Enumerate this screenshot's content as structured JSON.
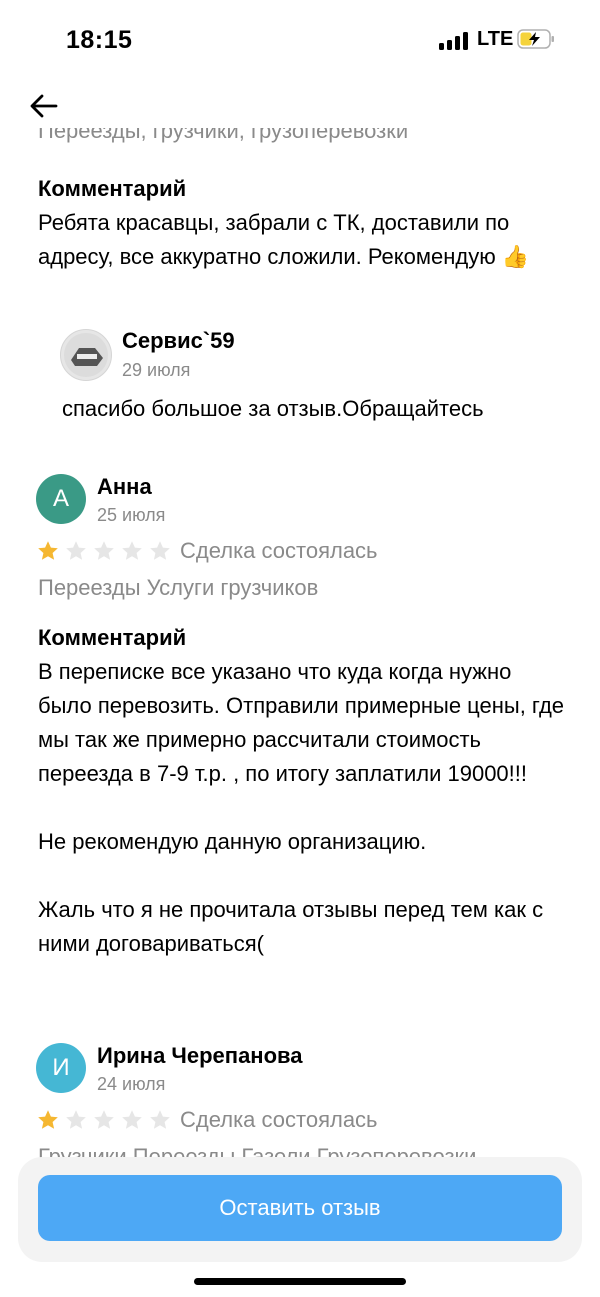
{
  "status_bar": {
    "time": "18:15",
    "network": "LTE"
  },
  "top": {
    "cut_text": "Переезды, грузчики, грузоперевозки"
  },
  "reviews": [
    {
      "comment_label": "Комментарий",
      "comment": "Ребята красавцы, забрали с ТК, доставили по адресу, все аккуратно сложили. Рекомендую 👍",
      "reply": {
        "author": "Сервис`59",
        "date": "29 июля",
        "text": "спасибо большое за отзыв.Обращайтесь"
      }
    },
    {
      "avatar_letter": "А",
      "avatar_color": "#3a9a86",
      "author": "Анна",
      "date": "25 июля",
      "rating": 1,
      "deal_status": "Сделка состоялась",
      "tags": "Переезды Услуги грузчиков",
      "comment_label": "Комментарий",
      "comment": "В переписке все указано что куда когда нужно было перевозить. Отправили примерные цены, где мы так же примерно рассчитали стоимость переезда в 7-9 т.р. , по итогу заплатили 19000!!!\n\nНе рекомендую данную организацию.\n\nЖаль что я не прочитала отзывы перед тем как с ними договариваться("
    },
    {
      "avatar_letter": "И",
      "avatar_color": "#45b7d4",
      "author": "Ирина Черепанова",
      "date": "24 июля",
      "rating": 1,
      "deal_status": "Сделка состоялась",
      "tags": "Грузчики Переезды Газели Грузоперевозки"
    }
  ],
  "colors": {
    "star_active": "#f5b731",
    "star_inactive": "#e6e6e6",
    "button": "#4da8f5"
  },
  "bottom": {
    "button_label": "Оставить отзыв"
  }
}
